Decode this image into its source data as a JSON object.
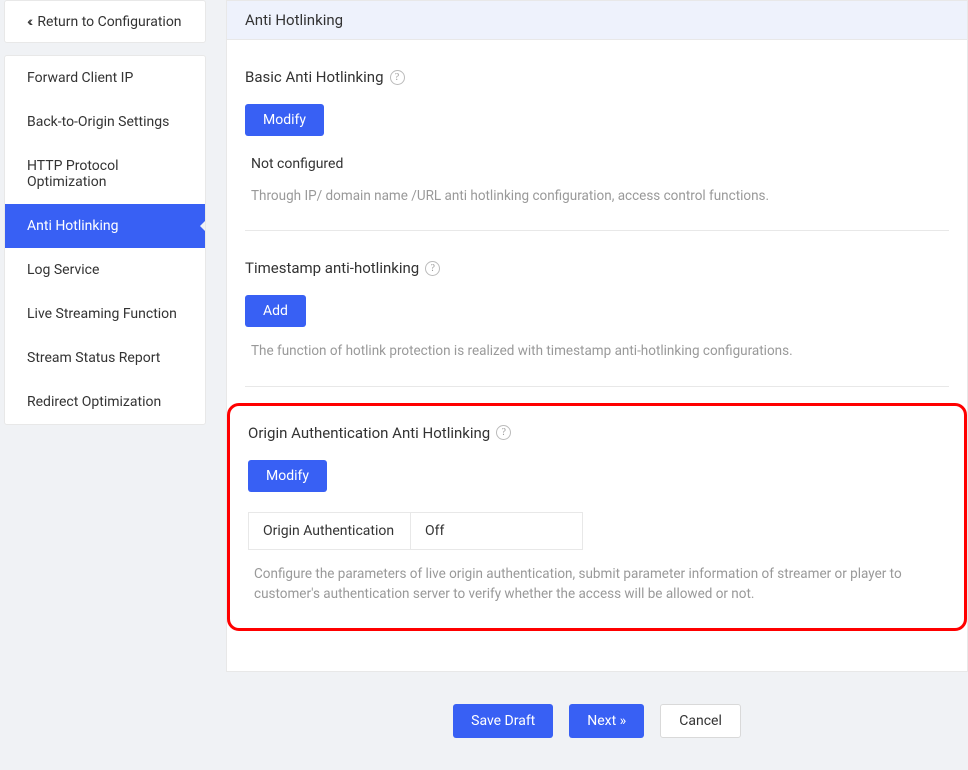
{
  "sidebar": {
    "return_label": "Return to Configuration",
    "items": [
      {
        "label": "Forward Client IP",
        "active": false
      },
      {
        "label": "Back-to-Origin Settings",
        "active": false
      },
      {
        "label": "HTTP Protocol Optimization",
        "active": false
      },
      {
        "label": "Anti Hotlinking",
        "active": true
      },
      {
        "label": "Log Service",
        "active": false
      },
      {
        "label": "Live Streaming Function",
        "active": false
      },
      {
        "label": "Stream Status Report",
        "active": false
      },
      {
        "label": "Redirect Optimization",
        "active": false
      }
    ]
  },
  "panel": {
    "header": "Anti Hotlinking"
  },
  "sections": {
    "basic": {
      "title": "Basic Anti Hotlinking",
      "button": "Modify",
      "status": "Not configured",
      "description": "Through IP/ domain name /URL anti hotlinking configuration, access control functions."
    },
    "timestamp": {
      "title": "Timestamp anti-hotlinking",
      "button": "Add",
      "description": "The function of hotlink protection is realized with timestamp anti-hotlinking configurations."
    },
    "origin": {
      "title": "Origin Authentication Anti Hotlinking",
      "button": "Modify",
      "table_label": "Origin Authentication",
      "table_value": "Off",
      "description": "Configure the parameters of live origin authentication, submit parameter information of streamer or player to customer's authentication server to verify whether the access will be allowed or not."
    }
  },
  "footer": {
    "save": "Save Draft",
    "next": "Next »",
    "cancel": "Cancel"
  }
}
